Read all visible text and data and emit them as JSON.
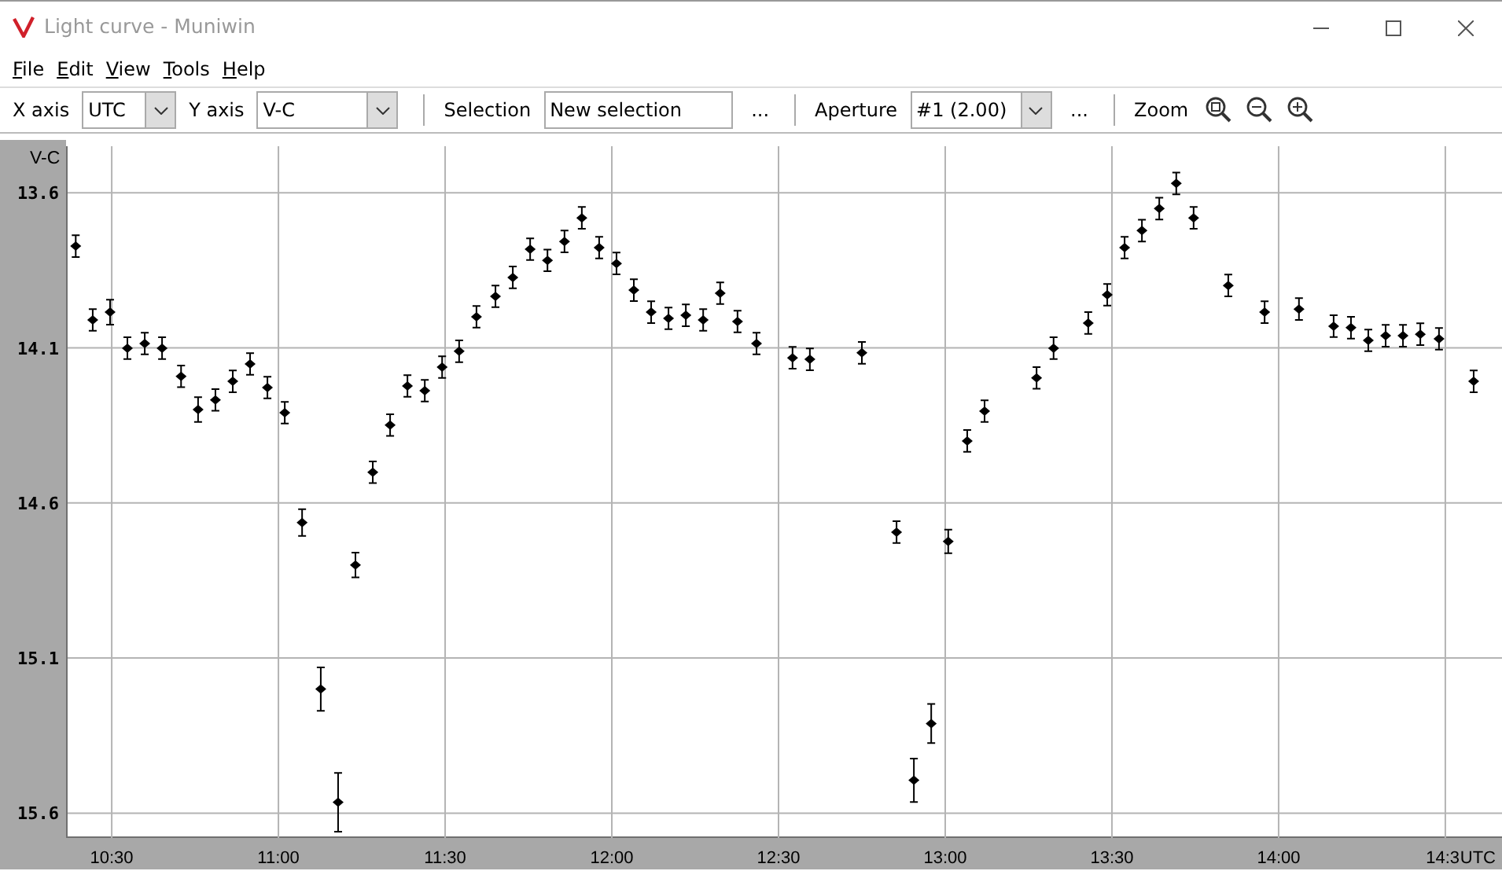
{
  "window": {
    "title": "Light curve - Muniwin"
  },
  "menu": [
    "File",
    "Edit",
    "View",
    "Tools",
    "Help"
  ],
  "toolbar": {
    "x_axis": {
      "label": "X axis",
      "value": "UTC"
    },
    "y_axis": {
      "label": "Y axis",
      "value": "V-C"
    },
    "selection": {
      "label": "Selection",
      "value": "New selection",
      "more": "..."
    },
    "aperture": {
      "label": "Aperture",
      "value": "#1 (2.00)",
      "more": "..."
    },
    "zoom": {
      "label": "Zoom"
    }
  },
  "chart": {
    "chart_data": {
      "type": "scatter",
      "xlabel": "UTC",
      "ylabel": "V-C",
      "xlim": [
        10.363,
        14.67
      ],
      "ylim": [
        15.68,
        13.45
      ],
      "xticks": [
        {
          "value": 10.5,
          "label": "10:30"
        },
        {
          "value": 11,
          "label": "11:00"
        },
        {
          "value": 11.5,
          "label": "11:30"
        },
        {
          "value": 12,
          "label": "12:00"
        },
        {
          "value": 12.5,
          "label": "12:30"
        },
        {
          "value": 13,
          "label": "13:00"
        },
        {
          "value": 13.5,
          "label": "13:30"
        },
        {
          "value": 14,
          "label": "14:00"
        },
        {
          "value": 14.5,
          "label": "14:3"
        }
      ],
      "yticks": [
        13.6,
        14.1,
        14.6,
        15.1,
        15.6
      ],
      "x": [
        10.392,
        10.443,
        10.495,
        10.547,
        10.599,
        10.651,
        10.708,
        10.759,
        10.811,
        10.863,
        10.915,
        10.967,
        11.019,
        11.071,
        11.127,
        11.179,
        11.231,
        11.283,
        11.335,
        11.387,
        11.439,
        11.491,
        11.542,
        11.594,
        11.651,
        11.703,
        11.755,
        11.807,
        11.858,
        11.91,
        11.962,
        12.014,
        12.066,
        12.118,
        12.17,
        12.222,
        12.274,
        12.325,
        12.377,
        12.434,
        12.542,
        12.594,
        12.75,
        12.854,
        12.906,
        12.958,
        13.009,
        13.066,
        13.118,
        13.274,
        13.325,
        13.429,
        13.486,
        13.538,
        13.59,
        13.642,
        13.693,
        13.745,
        13.849,
        13.958,
        14.061,
        14.165,
        14.217,
        14.269,
        14.321,
        14.373,
        14.425,
        14.481,
        14.585
      ],
      "grid": true,
      "series": [
        {
          "color": "#000000",
          "errors": [
            0.035,
            0.035,
            0.04,
            0.035,
            0.035,
            0.035,
            0.035,
            0.04,
            0.035,
            0.035,
            0.035,
            0.035,
            0.035,
            0.043,
            0.07,
            0.095,
            0.04,
            0.035,
            0.035,
            0.035,
            0.035,
            0.035,
            0.035,
            0.035,
            0.035,
            0.035,
            0.035,
            0.035,
            0.035,
            0.035,
            0.035,
            0.035,
            0.035,
            0.035,
            0.035,
            0.035,
            0.035,
            0.035,
            0.035,
            0.035,
            0.035,
            0.035,
            0.035,
            0.035,
            0.07,
            0.063,
            0.038,
            0.035,
            0.035,
            0.035,
            0.035,
            0.035,
            0.035,
            0.035,
            0.035,
            0.035,
            0.035,
            0.035,
            0.035,
            0.035,
            0.035,
            0.035,
            0.035,
            0.035,
            0.035,
            0.035,
            0.035,
            0.035,
            0.035
          ],
          "values": [
            13.772,
            14.01,
            13.985,
            14.101,
            14.086,
            14.101,
            14.192,
            14.299,
            14.268,
            14.208,
            14.152,
            14.228,
            14.309,
            14.663,
            15.2,
            15.565,
            14.8,
            14.501,
            14.349,
            14.223,
            14.238,
            14.162,
            14.111,
            14.0,
            13.934,
            13.873,
            13.782,
            13.818,
            13.757,
            13.681,
            13.777,
            13.828,
            13.914,
            13.985,
            14.005,
            13.995,
            14.01,
            13.924,
            14.015,
            14.086,
            14.132,
            14.137,
            14.116,
            14.694,
            15.494,
            15.311,
            14.724,
            14.4,
            14.304,
            14.197,
            14.101,
            14.02,
            13.929,
            13.777,
            13.722,
            13.651,
            13.57,
            13.681,
            13.899,
            13.985,
            13.975,
            14.03,
            14.035,
            14.076,
            14.061,
            14.061,
            14.056,
            14.071,
            14.208
          ]
        }
      ]
    }
  }
}
